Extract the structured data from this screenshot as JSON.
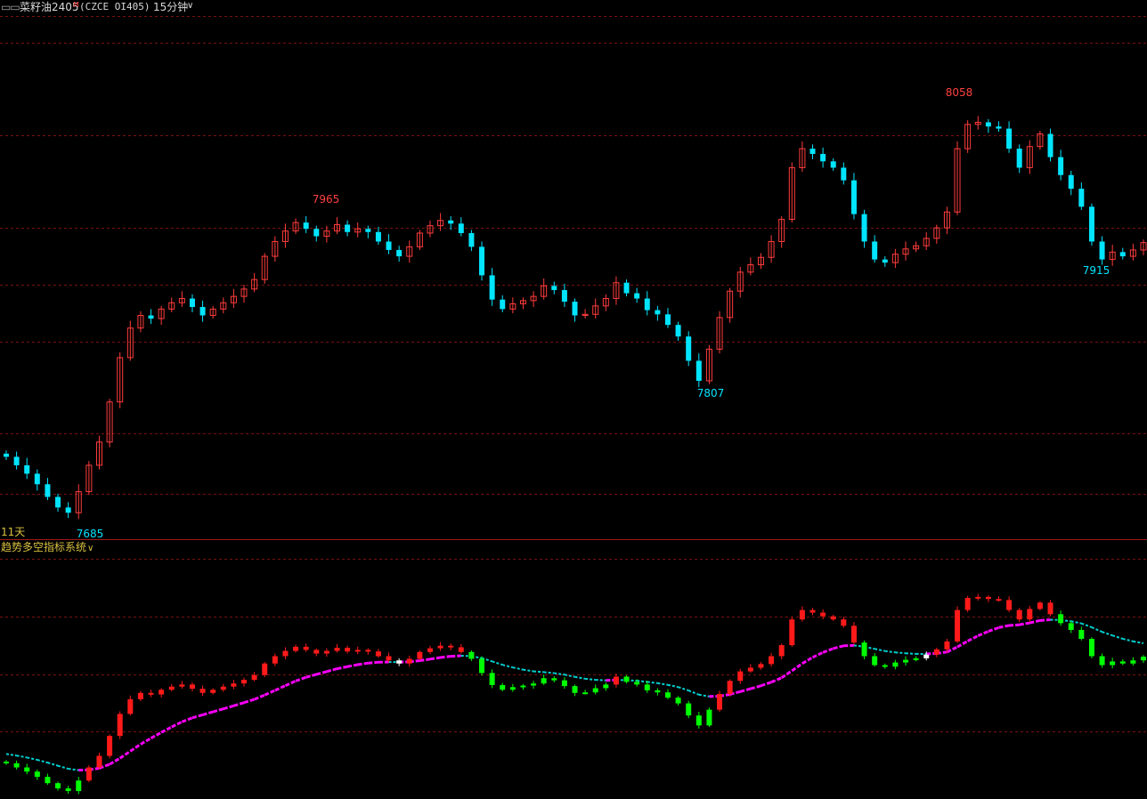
{
  "header": {
    "menu_icon": "dash-icon",
    "instrument_name": "菜籽油2405",
    "main_mark": "M",
    "contract_code": "(CZCE OI405)",
    "period": "15分钟",
    "dropdown_icon": "chevron-down-icon"
  },
  "main_panel": {
    "days_label": "11天",
    "annotations": [
      "8058",
      "7965",
      "7915",
      "7807",
      "7685"
    ]
  },
  "indicator_panel": {
    "title": "趋势多空指标系统",
    "dropdown_icon": "chevron-down-icon"
  },
  "colors": {
    "up": "#ff3c3c",
    "down": "#00e5ff",
    "grid": "#7a1010",
    "ind_up": "#ff1a1a",
    "ind_down": "#00ff00",
    "ind_neutral": "#ffffff",
    "trend_bull": "#ff00ff",
    "trend_bear": "#00d0d0",
    "label_text": "#c8b04a"
  },
  "chart_data": [
    {
      "type": "candlestick",
      "title": "菜籽油2405",
      "period": "15分钟",
      "y_range_approx": [
        7665,
        8095
      ],
      "annotations": [
        {
          "label": "8058",
          "kind": "high",
          "value": 8058
        },
        {
          "label": "7965",
          "kind": "high",
          "value": 7965
        },
        {
          "label": "7915",
          "kind": "low",
          "value": 7915
        },
        {
          "label": "7807",
          "kind": "low",
          "value": 7807
        },
        {
          "label": "7685",
          "kind": "low",
          "value": 7685
        }
      ],
      "close_path_approx": [
        7738,
        7730,
        7722,
        7712,
        7700,
        7690,
        7685,
        7705,
        7730,
        7752,
        7790,
        7832,
        7860,
        7872,
        7869,
        7878,
        7884,
        7888,
        7880,
        7872,
        7878,
        7884,
        7890,
        7897,
        7906,
        7928,
        7942,
        7952,
        7960,
        7954,
        7947,
        7952,
        7958,
        7951,
        7954,
        7951,
        7942,
        7934,
        7928,
        7937,
        7950,
        7957,
        7962,
        7959,
        7950,
        7937,
        7910,
        7887,
        7878,
        7883,
        7886,
        7890,
        7900,
        7896,
        7885,
        7872,
        7873,
        7881,
        7888,
        7903,
        7893,
        7888,
        7877,
        7873,
        7863,
        7852,
        7829,
        7810,
        7840,
        7870,
        7895,
        7913,
        7920,
        7927,
        7942,
        7963,
        8012,
        8030,
        8025,
        8018,
        8012,
        8000,
        7968,
        7942,
        7925,
        7922,
        7930,
        7935,
        7938,
        7945,
        7955,
        7970,
        8030,
        8053,
        8055,
        8051,
        8049,
        8030,
        8012,
        8032,
        8044,
        8022,
        8005,
        7992,
        7975,
        7942,
        7925,
        7932,
        7928,
        7934,
        7941
      ]
    },
    {
      "type": "candlestick-indicator",
      "title": "趋势多空指标系统",
      "series": [
        {
          "name": "price bars",
          "colors": "red up / green down / white neutral"
        },
        {
          "name": "trend line",
          "colors": "magenta bullish / cyan bearish"
        }
      ]
    }
  ]
}
